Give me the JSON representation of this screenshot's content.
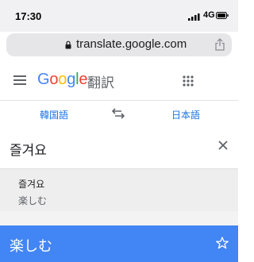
{
  "status_bar": {
    "time": "17:30",
    "network": "4G",
    "icons": [
      "signal-icon",
      "battery-icon"
    ]
  },
  "browser": {
    "url": "translate.google.com",
    "icons": [
      "lock-icon",
      "share-icon"
    ]
  },
  "app": {
    "logo_letters": [
      "G",
      "o",
      "o",
      "g",
      "l",
      "e"
    ],
    "product_name": "翻訳",
    "icons": [
      "menu-icon",
      "apps-icon"
    ]
  },
  "language_bar": {
    "source_language": "韓国語",
    "target_language": "日本語",
    "swap_icon": "swap-icon"
  },
  "input": {
    "text": "즐겨요",
    "clear_icon": "close-icon"
  },
  "suggestion": {
    "source": "즐겨요",
    "translation": "楽しむ"
  },
  "result": {
    "translation": "楽しむ",
    "star_icon": "star-icon"
  },
  "colors": {
    "accent_blue": "#1a73e8",
    "result_bar": "#4285f4",
    "google_blue": "#4285f4",
    "google_red": "#ea4335",
    "google_yellow": "#fbbc05",
    "google_green": "#34a853"
  }
}
